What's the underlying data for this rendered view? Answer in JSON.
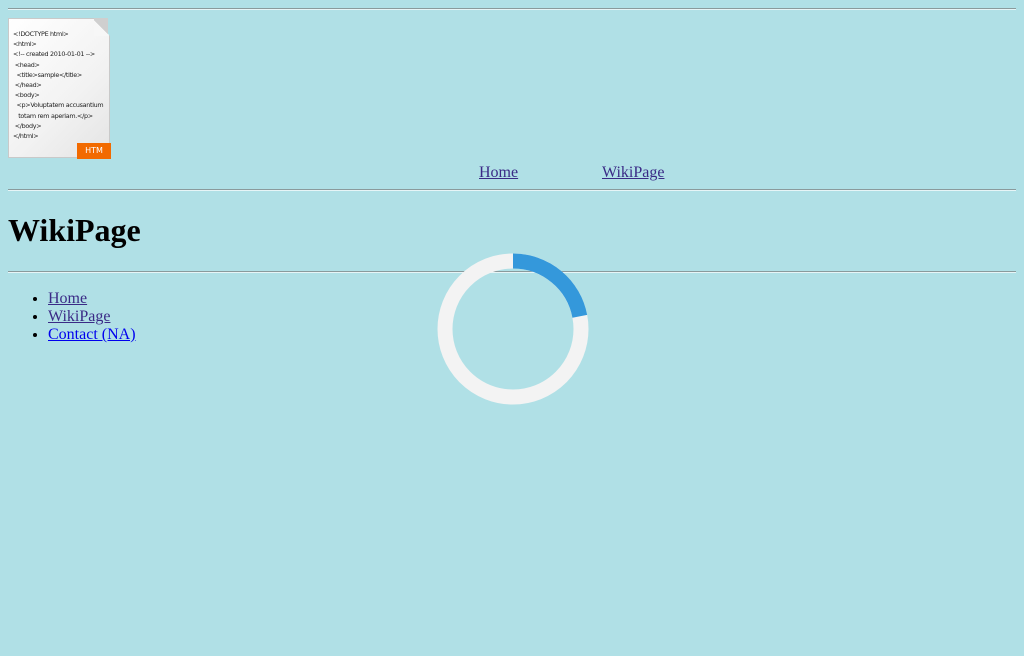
{
  "logo": {
    "code_lines": [
      "<!DOCTYPE html>",
      "<html>",
      "<!-- created 2010-01-01 -->",
      " <head>",
      "  <title>sample</title>",
      " </head>",
      " <body>",
      "  <p>Voluptatem accusantium",
      "   totam rem aperiam.</p>",
      " </body>",
      "</html>"
    ],
    "tag": "HTM"
  },
  "nav": {
    "home": "Home",
    "wiki": "WikiPage"
  },
  "page": {
    "title": "WikiPage"
  },
  "links": [
    "Home",
    "WikiPage",
    "Contact (NA)"
  ],
  "loading": {
    "progress": 0.22,
    "track_color": "#f3f3f3",
    "arc_color": "#3498db"
  },
  "colors": {
    "background": "#b0e0e6",
    "visited_link": "#3a2a86",
    "link": "#0000ee",
    "tag": "#f26a00"
  }
}
